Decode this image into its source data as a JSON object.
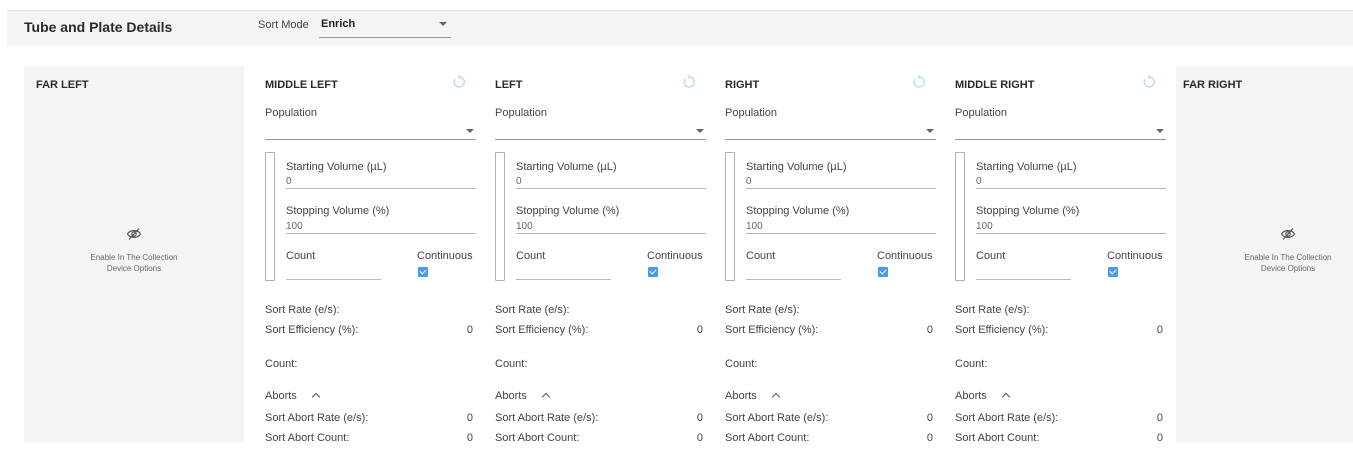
{
  "header": {
    "title": "Tube and Plate Details",
    "sort_mode_label": "Sort Mode",
    "sort_mode_value": "Enrich"
  },
  "disabled": {
    "far_left": {
      "title": "FAR LEFT",
      "message_line1": "Enable In The Collection",
      "message_line2": "Device Options"
    },
    "far_right": {
      "title": "FAR RIGHT",
      "message_line1": "Enable In The Collection",
      "message_line2": "Device Options"
    }
  },
  "labels": {
    "population": "Population",
    "starting_volume": "Starting Volume (µL)",
    "stopping_volume": "Stopping Volume (%)",
    "count": "Count",
    "continuous": "Continuous",
    "sort_rate": "Sort Rate (e/s):",
    "sort_efficiency": "Sort Efficiency (%):",
    "count_stat": "Count:",
    "aborts": "Aborts",
    "sort_abort_rate": "Sort Abort Rate (e/s):",
    "sort_abort_count": "Sort Abort Count:"
  },
  "panels": [
    {
      "title": "MIDDLE LEFT",
      "population": "",
      "starting_volume": "0",
      "stopping_volume": "100",
      "count": "",
      "continuous": true,
      "sort_rate": "",
      "sort_efficiency": "0",
      "count_stat": "",
      "sort_abort_rate": "0",
      "sort_abort_count": "0"
    },
    {
      "title": "LEFT",
      "population": "",
      "starting_volume": "0",
      "stopping_volume": "100",
      "count": "",
      "continuous": true,
      "sort_rate": "",
      "sort_efficiency": "0",
      "count_stat": "",
      "sort_abort_rate": "0",
      "sort_abort_count": "0"
    },
    {
      "title": "RIGHT",
      "population": "",
      "starting_volume": "0",
      "stopping_volume": "100",
      "count": "",
      "continuous": true,
      "sort_rate": "",
      "sort_efficiency": "0",
      "count_stat": "",
      "sort_abort_rate": "0",
      "sort_abort_count": "0"
    },
    {
      "title": "MIDDLE RIGHT",
      "population": "",
      "starting_volume": "0",
      "stopping_volume": "100",
      "count": "",
      "continuous": true,
      "sort_rate": "",
      "sort_efficiency": "0",
      "count_stat": "",
      "sort_abort_rate": "0",
      "sort_abort_count": "0"
    }
  ],
  "colors": {
    "accent": "#4a9be8",
    "refresh_icon": "#bcd9f4",
    "section_bg": "#f4f4f4"
  },
  "icons": {
    "hidden": "eye-off-icon",
    "refresh": "refresh-icon",
    "dropdown": "chevron-down-icon",
    "collapse": "chevron-up-icon"
  }
}
